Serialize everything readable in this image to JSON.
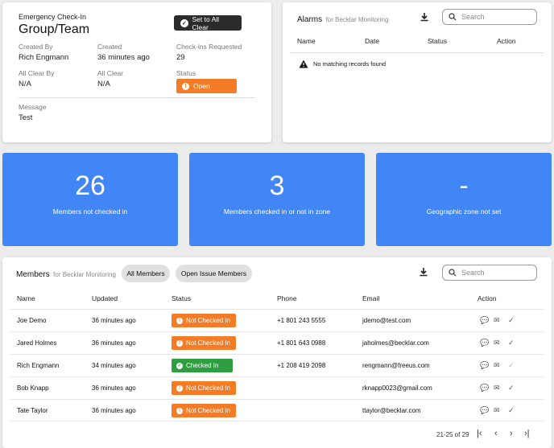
{
  "checkin": {
    "subtitle": "Emergency Check-In",
    "title": "Group/Team",
    "all_clear_button": "Set to All Clear",
    "created_by_label": "Created By",
    "created_by": "Rich Engmann",
    "created_label": "Created",
    "created": "36 minutes ago",
    "requested_label": "Check-ins Requested",
    "requested": "29",
    "all_clear_by_label": "All Clear By",
    "all_clear_by": "N/A",
    "all_clear_label": "All Clear",
    "all_clear": "N/A",
    "status_label": "Status",
    "status": "Open",
    "message_label": "Message",
    "message": "Test"
  },
  "alarms": {
    "title": "Alarms",
    "for_text": "for Becklar Monitoring",
    "search_placeholder": "Search",
    "columns": [
      "Name",
      "Date",
      "Status",
      "Action"
    ],
    "empty_message": "No matching records found"
  },
  "stats": [
    {
      "value": "26",
      "label": "Members not checked in"
    },
    {
      "value": "3",
      "label": "Members checked in or not in zone"
    },
    {
      "value": "-",
      "label": "Geographic zone not set"
    }
  ],
  "members": {
    "title": "Members",
    "for_text": "for Becklar Monitoring",
    "tab_all": "All Members",
    "tab_open": "Open Issue Members",
    "search_placeholder": "Search",
    "columns": [
      "Name",
      "Updated",
      "Status",
      "Phone",
      "Email",
      "Action"
    ],
    "rows": [
      {
        "name": "Joe Demo",
        "updated": "36 minutes ago",
        "status": "Not Checked In",
        "phone": "+1 801 243 5555",
        "email": "jdemo@test.com"
      },
      {
        "name": "Jared Holmes",
        "updated": "36 minutes ago",
        "status": "Not Checked In",
        "phone": "+1 801 643 0988",
        "email": "jaholmes@becklar.com"
      },
      {
        "name": "Rich Engmann",
        "updated": "34 minutes ago",
        "status": "Checked In",
        "phone": "+1 208 419 2098",
        "email": "rengmann@freeus.com"
      },
      {
        "name": "Bob Knapp",
        "updated": "36 minutes ago",
        "status": "Not Checked In",
        "phone": "",
        "email": "rknapp0023@gmail.com"
      },
      {
        "name": "Tate Taylor",
        "updated": "36 minutes ago",
        "status": "Not Checked In",
        "phone": "",
        "email": "ttaylor@becklar.com"
      }
    ],
    "pagination": "21-25 of 29"
  },
  "colors": {
    "accent": "#4285f4",
    "open": "#f47c26",
    "checked_in": "#2e9e40"
  }
}
